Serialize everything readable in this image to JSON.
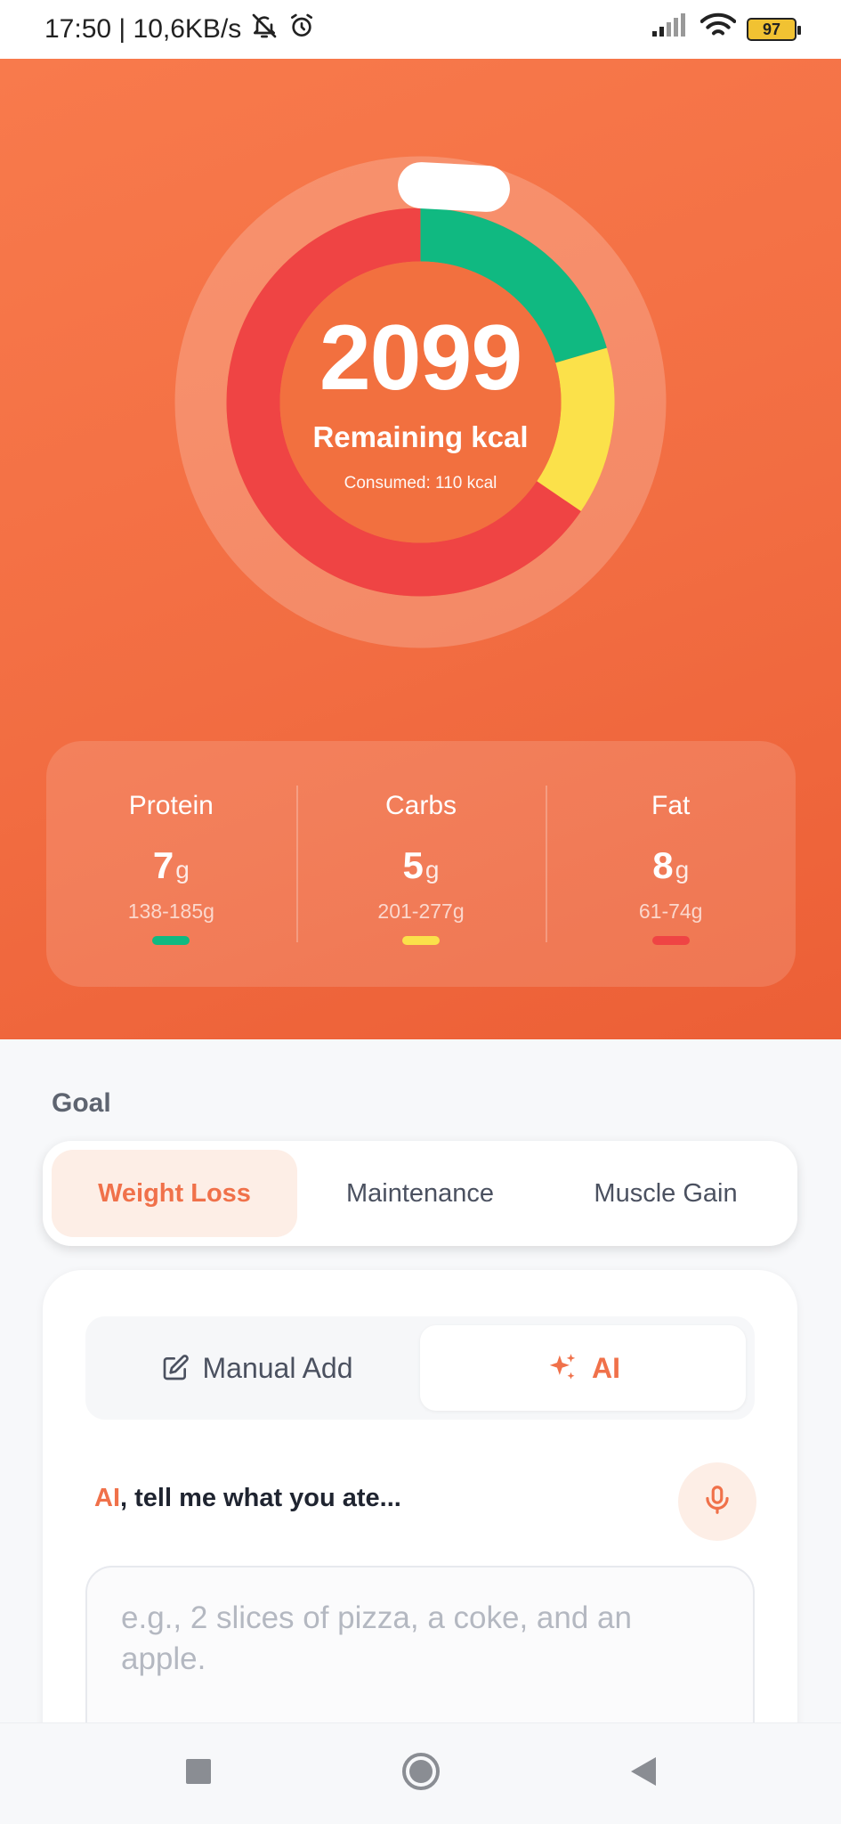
{
  "status_bar": {
    "time_speed": "17:50 | 10,6KB/s",
    "battery": "97"
  },
  "summary": {
    "remaining_value": "2099",
    "remaining_label": "Remaining kcal",
    "consumed_text": "Consumed: 110 kcal",
    "ring_segments": [
      {
        "name": "Protein",
        "fraction": 0.205,
        "color": "#10b981"
      },
      {
        "name": "Carbs",
        "fraction": 0.14,
        "color": "#fbe14a"
      },
      {
        "name": "Fat",
        "fraction": 0.655,
        "color": "#ef4444"
      }
    ]
  },
  "macros": [
    {
      "name": "Protein",
      "value": "7",
      "unit": "g",
      "range": "138-185g",
      "color": "#10b981"
    },
    {
      "name": "Carbs",
      "value": "5",
      "unit": "g",
      "range": "201-277g",
      "color": "#fbe14a"
    },
    {
      "name": "Fat",
      "value": "8",
      "unit": "g",
      "range": "61-74g",
      "color": "#ef4444"
    }
  ],
  "goal": {
    "label": "Goal",
    "options": [
      "Weight Loss",
      "Maintenance",
      "Muscle Gain"
    ],
    "selected": "Weight Loss"
  },
  "add_food": {
    "modes": [
      "Manual Add",
      "AI"
    ],
    "active_mode": "AI",
    "prompt_accent": "AI",
    "prompt_rest": ", tell me what you ate...",
    "placeholder": "e.g., 2 slices of pizza, a coke, and an apple."
  },
  "colors": {
    "accent": "#f0714a",
    "hero": "#f26d42"
  }
}
